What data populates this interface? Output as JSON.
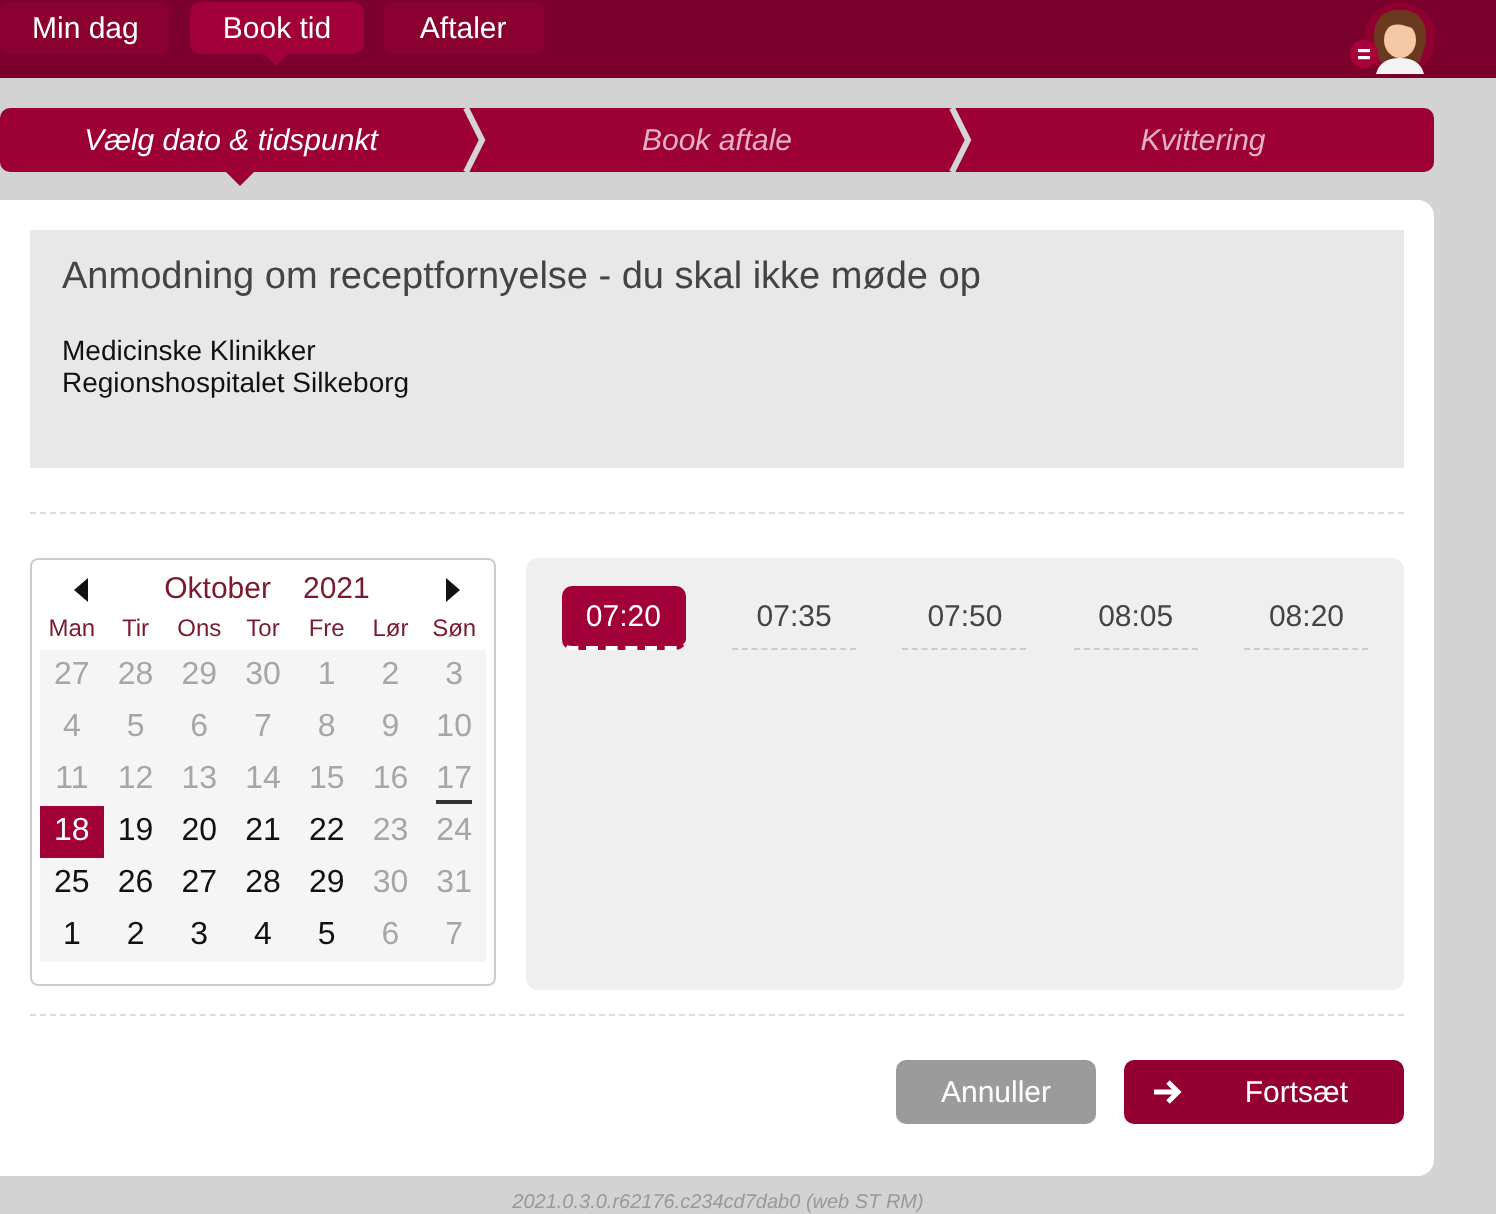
{
  "nav_tabs": [
    {
      "label": "Min dag",
      "selected": false
    },
    {
      "label": "Book tid",
      "selected": true
    },
    {
      "label": "Aftaler",
      "selected": false
    }
  ],
  "steps": [
    {
      "label": "Vælg dato & tidspunkt",
      "selected": true
    },
    {
      "label": "Book aftale",
      "selected": false
    },
    {
      "label": "Kvittering",
      "selected": false
    }
  ],
  "info": {
    "title": "Anmodning om receptfornyelse - du skal ikke møde op",
    "lines": [
      "Medicinske Klinikker",
      "Regionshospitalet Silkeborg"
    ]
  },
  "calendar": {
    "month": "Oktober",
    "year": "2021",
    "weekdays": [
      "Man",
      "Tir",
      "Ons",
      "Tor",
      "Fre",
      "Lør",
      "Søn"
    ],
    "days": [
      {
        "label": "27",
        "disabled": true,
        "selected": false,
        "today": false
      },
      {
        "label": "28",
        "disabled": true,
        "selected": false,
        "today": false
      },
      {
        "label": "29",
        "disabled": true,
        "selected": false,
        "today": false
      },
      {
        "label": "30",
        "disabled": true,
        "selected": false,
        "today": false
      },
      {
        "label": "1",
        "disabled": true,
        "selected": false,
        "today": false
      },
      {
        "label": "2",
        "disabled": true,
        "selected": false,
        "today": false
      },
      {
        "label": "3",
        "disabled": true,
        "selected": false,
        "today": false
      },
      {
        "label": "4",
        "disabled": true,
        "selected": false,
        "today": false
      },
      {
        "label": "5",
        "disabled": true,
        "selected": false,
        "today": false
      },
      {
        "label": "6",
        "disabled": true,
        "selected": false,
        "today": false
      },
      {
        "label": "7",
        "disabled": true,
        "selected": false,
        "today": false
      },
      {
        "label": "8",
        "disabled": true,
        "selected": false,
        "today": false
      },
      {
        "label": "9",
        "disabled": true,
        "selected": false,
        "today": false
      },
      {
        "label": "10",
        "disabled": true,
        "selected": false,
        "today": false
      },
      {
        "label": "11",
        "disabled": true,
        "selected": false,
        "today": false
      },
      {
        "label": "12",
        "disabled": true,
        "selected": false,
        "today": false
      },
      {
        "label": "13",
        "disabled": true,
        "selected": false,
        "today": false
      },
      {
        "label": "14",
        "disabled": true,
        "selected": false,
        "today": false
      },
      {
        "label": "15",
        "disabled": true,
        "selected": false,
        "today": false
      },
      {
        "label": "16",
        "disabled": true,
        "selected": false,
        "today": false
      },
      {
        "label": "17",
        "disabled": true,
        "selected": false,
        "today": true
      },
      {
        "label": "18",
        "disabled": false,
        "selected": true,
        "today": false
      },
      {
        "label": "19",
        "disabled": false,
        "selected": false,
        "today": false
      },
      {
        "label": "20",
        "disabled": false,
        "selected": false,
        "today": false
      },
      {
        "label": "21",
        "disabled": false,
        "selected": false,
        "today": false
      },
      {
        "label": "22",
        "disabled": false,
        "selected": false,
        "today": false
      },
      {
        "label": "23",
        "disabled": true,
        "selected": false,
        "today": false
      },
      {
        "label": "24",
        "disabled": true,
        "selected": false,
        "today": false
      },
      {
        "label": "25",
        "disabled": false,
        "selected": false,
        "today": false
      },
      {
        "label": "26",
        "disabled": false,
        "selected": false,
        "today": false
      },
      {
        "label": "27",
        "disabled": false,
        "selected": false,
        "today": false
      },
      {
        "label": "28",
        "disabled": false,
        "selected": false,
        "today": false
      },
      {
        "label": "29",
        "disabled": false,
        "selected": false,
        "today": false
      },
      {
        "label": "30",
        "disabled": true,
        "selected": false,
        "today": false
      },
      {
        "label": "31",
        "disabled": true,
        "selected": false,
        "today": false
      },
      {
        "label": "1",
        "disabled": false,
        "selected": false,
        "today": false
      },
      {
        "label": "2",
        "disabled": false,
        "selected": false,
        "today": false
      },
      {
        "label": "3",
        "disabled": false,
        "selected": false,
        "today": false
      },
      {
        "label": "4",
        "disabled": false,
        "selected": false,
        "today": false
      },
      {
        "label": "5",
        "disabled": false,
        "selected": false,
        "today": false
      },
      {
        "label": "6",
        "disabled": true,
        "selected": false,
        "today": false
      },
      {
        "label": "7",
        "disabled": true,
        "selected": false,
        "today": false
      }
    ]
  },
  "times": [
    {
      "label": "07:20",
      "selected": true
    },
    {
      "label": "07:35",
      "selected": false
    },
    {
      "label": "07:50",
      "selected": false
    },
    {
      "label": "08:05",
      "selected": false
    },
    {
      "label": "08:20",
      "selected": false
    }
  ],
  "buttons": [
    {
      "label": "Annuller",
      "kind": "cancel"
    },
    {
      "label": "Fortsæt",
      "kind": "next"
    }
  ],
  "version": "2021.0.3.0.r62176.c234cd7dab0 (web ST RM)"
}
